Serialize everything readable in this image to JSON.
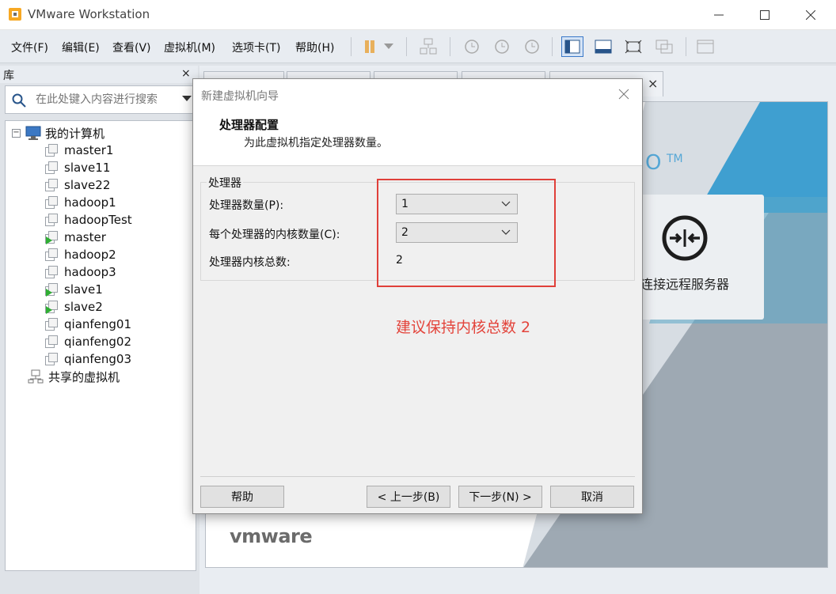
{
  "window": {
    "title": "VMware Workstation"
  },
  "menu": {
    "items": [
      "文件(F)",
      "编辑(E)",
      "查看(V)",
      "虚拟机(M)",
      "选项卡(T)",
      "帮助(H)"
    ]
  },
  "library": {
    "title": "库",
    "close": "×",
    "search_placeholder": "在此处键入内容进行搜索",
    "root_label": "我的计算机",
    "vms": [
      {
        "name": "master1",
        "running": false
      },
      {
        "name": "slave11",
        "running": false
      },
      {
        "name": "slave22",
        "running": false
      },
      {
        "name": "hadoop1",
        "running": false
      },
      {
        "name": "hadoopTest",
        "running": false
      },
      {
        "name": "master",
        "running": true
      },
      {
        "name": "hadoop2",
        "running": false
      },
      {
        "name": "hadoop3",
        "running": false
      },
      {
        "name": "slave1",
        "running": true
      },
      {
        "name": "slave2",
        "running": true
      },
      {
        "name": "qianfeng01",
        "running": false
      },
      {
        "name": "qianfeng02",
        "running": false
      },
      {
        "name": "qianfeng03",
        "running": false
      }
    ],
    "shared_label": "共享的虚拟机"
  },
  "home": {
    "remote_server_label": "连接远程服务器",
    "logo_text": "vmware",
    "tm": "TM"
  },
  "dialog": {
    "title": "新建虚拟机向导",
    "heading": "处理器配置",
    "subheading": "为此虚拟机指定处理器数量。",
    "group_title": "处理器",
    "processor_count_label": "处理器数量(P):",
    "processor_count_value": "1",
    "cores_per_processor_label": "每个处理器的内核数量(C):",
    "cores_per_processor_value": "2",
    "total_cores_label": "处理器内核总数:",
    "total_cores_value": "2",
    "buttons": {
      "help": "帮助",
      "back": "< 上一步(B)",
      "next": "下一步(N) >",
      "cancel": "取消"
    }
  },
  "annotation": {
    "note": "建议保持内核总数 2",
    "color": "#e3443b"
  }
}
